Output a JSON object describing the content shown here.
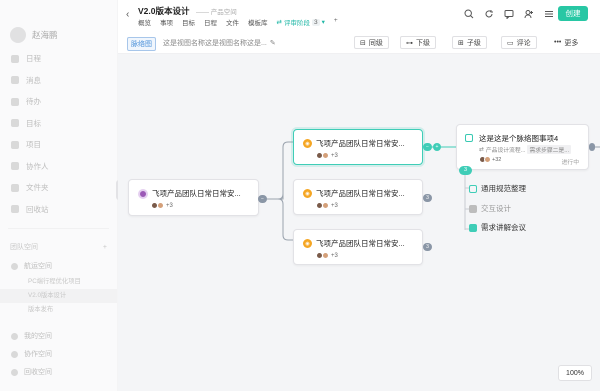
{
  "sidebar": {
    "user_name": "赵海鹏",
    "items": [
      "日程",
      "消息",
      "待办",
      "目标",
      "项目",
      "协作人",
      "文件夹",
      "回收站"
    ],
    "section_label": "团队空间",
    "spaces": [
      "航运空间",
      "PC端行程优化项目",
      "V2.0版本设计",
      "版本发布"
    ],
    "sub_space_2": "我的空间",
    "sub_space_3": "协作空间",
    "footer": "回收空间"
  },
  "header": {
    "title": "V2.0版本设计",
    "breadcrumb": "—— 产品空间",
    "tabs": [
      "概览",
      "事项",
      "目标",
      "日程",
      "文件",
      "模板库"
    ],
    "active_tab": "评审阶段",
    "active_tab_count": "3",
    "create_label": "创建"
  },
  "toolbar": {
    "view_chip": "脉络图",
    "view_name": "这是视图名称这是视图名称这是...",
    "buttons": [
      "同级",
      "下级",
      "子级",
      "评论",
      "更多"
    ]
  },
  "nodes": {
    "root": {
      "title": "飞项产品团队日常日常安...",
      "count": "+3"
    },
    "child1": {
      "title": "飞项产品团队日常日常安...",
      "count": "+3"
    },
    "child2": {
      "title": "飞项产品团队日常日常安...",
      "count": "+3"
    },
    "child3": {
      "title": "飞项产品团队日常日常安...",
      "count": "+3"
    },
    "leaf": {
      "title": "这是这是个脉络图事项4",
      "sub": "产品设计流程...",
      "tag": "需求步骤二是...",
      "count": "+32",
      "status": "进行中"
    }
  },
  "subtasks": {
    "badge": "3",
    "items": [
      "通用规范整理",
      "交互设计",
      "需求讲解会议"
    ]
  },
  "zoom": "100%"
}
